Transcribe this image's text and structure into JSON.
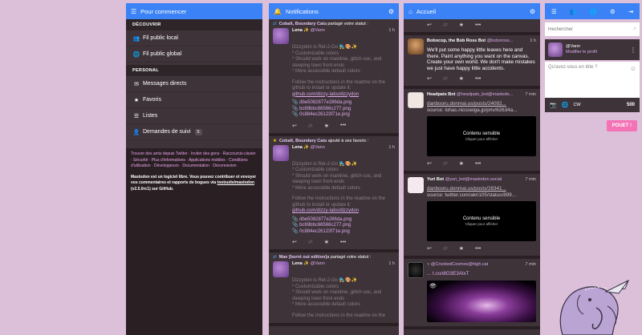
{
  "col1": {
    "title": "Pour commencer",
    "discover": "DÉCOUVRIR",
    "items_discover": [
      {
        "icon": "users-icon",
        "label": "Fil public local"
      },
      {
        "icon": "globe-icon",
        "label": "Fil public global"
      }
    ],
    "personal": "PERSONAL",
    "items_personal": [
      {
        "icon": "envelope-icon",
        "label": "Messages directs"
      },
      {
        "icon": "star-icon",
        "label": "Favoris"
      },
      {
        "icon": "list-icon",
        "label": "Listes"
      },
      {
        "icon": "user-plus-icon",
        "label": "Demandes de suivi",
        "badge": "5"
      }
    ],
    "links": "Trouver des amis depuis Twitter · Inviter des gens · Raccourcis-clavier · Sécurité · Plus d'informations · Applications mobiles · Conditions d'utilisation · Développeurs · Documentation · Déconnexion",
    "about_pre": "Mastodon est un logiciel libre. Vous pouvez contribuer et envoyer vos commentaires et rapports de bogues via ",
    "about_link": "tootsuite/mastodon",
    "about_post": " (v2.5.0rc1) sur GitHub."
  },
  "col2": {
    "title": "Notifications",
    "notifs": [
      {
        "kind": "reblog",
        "actor": "Cobalt, Boundary Cat",
        "action": " a partagé votre statut :",
        "name": "Lena ✨",
        "user": "@Vann",
        "time": "1 h",
        "lines": [
          "Dizzydon is Ret-2-Go 🛼🎨✨",
          "* Customizable colors",
          "* Should work on mainline, glitch-soc, and sleeping town front ends",
          "* More accessible default colors",
          "",
          "Follow the instructions in the readme on the github to install or update it:"
        ],
        "link": "github.com/dizzy-labs/dizzydon",
        "files": [
          "dbe5082877e286da.png",
          "bc69bbc66566c277.png",
          "0c884ec26123f71e.png"
        ]
      },
      {
        "kind": "favourite",
        "actor": "Cobalt, Boundary Cat",
        "action": " a ajouté à ses favoris :",
        "name": "Lena ✨",
        "user": "@Vann",
        "time": "1 h",
        "lines": [
          "Dizzydon is Ret-2-Go 🛼🎨✨",
          "* Customizable colors",
          "* Should work on mainline, glitch-soc, and sleeping town front ends",
          "* More accessible default colors",
          "",
          "Follow the instructions in the readme on the github to install or update it:"
        ],
        "link": "github.com/dizzy-labs/dizzydon",
        "files": [
          "dbe5082877e286da.png",
          "bc69bbc66566c277.png",
          "0c884ec26123f71e.png"
        ]
      },
      {
        "kind": "reblog",
        "actor": "Mae [burnt out edition]",
        "action": " a partagé votre statut :",
        "name": "Lena ✨",
        "user": "@Vann",
        "time": "1 h",
        "lines": [
          "Dizzydon is Ret-2-Go 🛼🎨✨",
          "* Customizable colors",
          "* Should work on mainline, glitch-soc, and sleeping town front ends",
          "* More accessible default colors",
          "",
          "Follow the instructions in the readme on the"
        ],
        "link": "",
        "files": []
      }
    ]
  },
  "col3": {
    "title": "Accueil",
    "posts": [
      {
        "name": "Bobocop, the Bob Ross Bot",
        "user": "@boboross...",
        "time": "1 h",
        "text": "We'll put some happy little leaves here and there. Paint anything you want on the canvas. Create your own world. We don't make mistakes we just have happy little accidents.",
        "media": null
      },
      {
        "name": "Headpats Bot",
        "user": "@headpats_bot@mastodo...",
        "time": "7 min",
        "text": "danbooru.donmai.us/posts/24092...",
        "source": "source: lohas.nicoseiga.jp/priv/62634a...",
        "media": {
          "t1": "Contenu sensible",
          "t2": "Cliquer pour afficher"
        }
      },
      {
        "name": "Yuri Bot",
        "user": "@yuri_bot@mastodon.social",
        "time": "7 min",
        "text": "danbooru.donmai.us/posts/28341...",
        "source": "source: twitter.com/akri105/status/899...",
        "media": {
          "t1": "Contenu sensible",
          "t2": "Cliquer pour afficher"
        }
      },
      {
        "name": "",
        "user": "@CrookedCosmos@high.cat",
        "time": "7 min",
        "text": "... t.co/dlO3E3AlxT",
        "media": {
          "t1": "",
          "t2": ""
        }
      }
    ]
  },
  "col4": {
    "nav": [
      "pencil-icon",
      "users-icon",
      "globe-icon",
      "gear-icon",
      "logout-icon"
    ],
    "search_placeholder": "Rechercher",
    "acct_user": "@Vann",
    "acct_edit": "Modifier le profil",
    "compose_placeholder": "Qu'avez-vous en tête ?",
    "cw": "CW",
    "count": "500",
    "post": "POUET !"
  }
}
